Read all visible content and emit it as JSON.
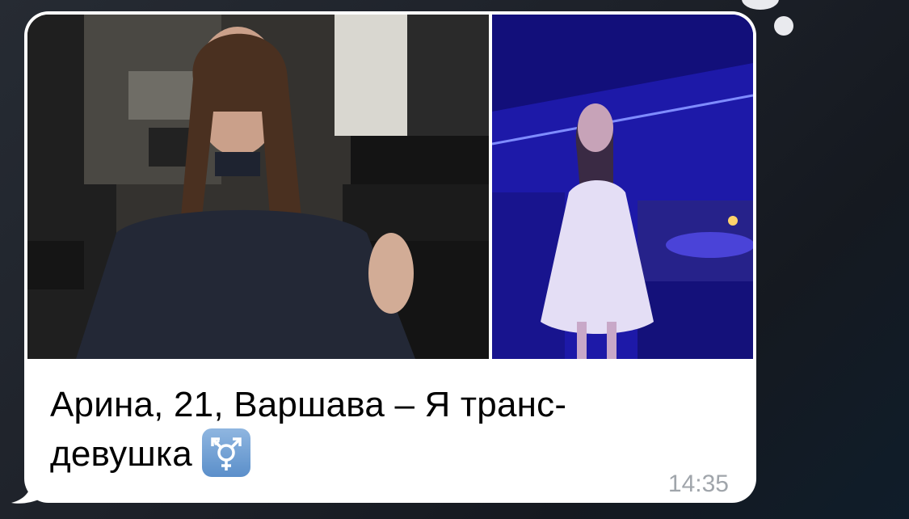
{
  "message": {
    "caption_line1": "Арина, 21, Варшава – Я транс-",
    "caption_line2": "девушка",
    "emoji": "transgender-symbol-icon",
    "time": "14:35"
  },
  "colors": {
    "bubble": "#ffffff",
    "time": "#a0a5ab",
    "text": "#000000",
    "emoji_bg": "#6f9ed4"
  }
}
